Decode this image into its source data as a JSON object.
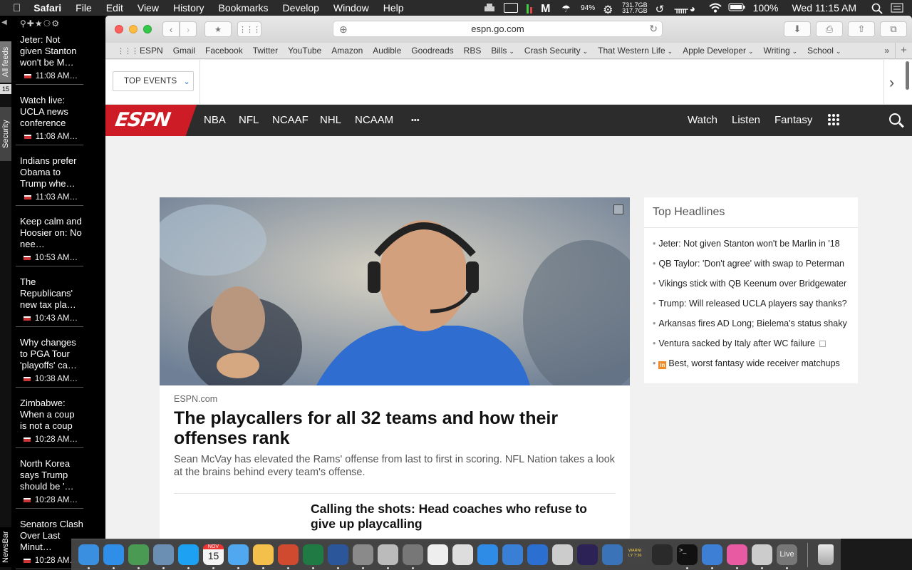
{
  "menubar": {
    "app": "Safari",
    "items": [
      "File",
      "Edit",
      "View",
      "History",
      "Bookmarks",
      "Develop",
      "Window",
      "Help"
    ],
    "battery_icon_pct": "94%",
    "disk_top": "731.7GB",
    "disk_bottom": "317.7GB",
    "battery_pct": "100%",
    "clock": "Wed 11:15 AM"
  },
  "newsbar": {
    "tab_all_feeds": "All feeds",
    "tab_count": "15",
    "tab_security": "Security",
    "tab_newsbar": "NewsBar",
    "items": [
      {
        "title": "Jeter: Not given Stanton won't be M…",
        "time": "11:08 AM…"
      },
      {
        "title": "Watch live: UCLA news conference",
        "time": "11:08 AM…"
      },
      {
        "title": "Indians prefer Obama to Trump whe…",
        "time": "11:03 AM…"
      },
      {
        "title": "Keep calm and Hoosier on: No nee…",
        "time": "10:53 AM…"
      },
      {
        "title": "The Republicans' new tax pla…",
        "time": "10:43 AM…"
      },
      {
        "title": "Why changes to PGA Tour 'playoffs' ca…",
        "time": "10:38 AM…"
      },
      {
        "title": "Zimbabwe: When a coup is not a coup",
        "time": "10:28 AM…"
      },
      {
        "title": "North Korea says Trump should be '…",
        "time": "10:28 AM…"
      },
      {
        "title": "Senators Clash Over Last Minut…",
        "time": "10:28 AM…"
      }
    ]
  },
  "browser": {
    "url": "espn.go.com",
    "favorites": [
      {
        "label": "ESPN",
        "menu": false
      },
      {
        "label": "Gmail",
        "menu": false
      },
      {
        "label": "Facebook",
        "menu": false
      },
      {
        "label": "Twitter",
        "menu": false
      },
      {
        "label": "YouTube",
        "menu": false
      },
      {
        "label": "Amazon",
        "menu": false
      },
      {
        "label": "Audible",
        "menu": false
      },
      {
        "label": "Goodreads",
        "menu": false
      },
      {
        "label": "RBS",
        "menu": false
      },
      {
        "label": "Bills",
        "menu": true
      },
      {
        "label": "Crash Security",
        "menu": true
      },
      {
        "label": "That Western Life",
        "menu": true
      },
      {
        "label": "Apple Developer",
        "menu": true
      },
      {
        "label": "Writing",
        "menu": true
      },
      {
        "label": "School",
        "menu": true
      }
    ],
    "favorites_more": "»"
  },
  "page": {
    "top_events": "TOP EVENTS",
    "logo": "ESPN",
    "nav_left": [
      "NBA",
      "NFL",
      "NCAAF",
      "NHL",
      "NCAAM"
    ],
    "nav_more": "•••",
    "nav_right": [
      "Watch",
      "Listen",
      "Fantasy"
    ],
    "hero": {
      "source": "ESPN.com",
      "title": "The playcallers for all 32 teams and how their offenses rank",
      "description": "Sean McVay has elevated the Rams' offense from last to first in scoring. NFL Nation takes a look at the brains behind every team's offense."
    },
    "sub_story": {
      "title": "Calling the shots: Head coaches who refuse to give up playcalling"
    },
    "headlines": {
      "title": "Top Headlines",
      "items": [
        {
          "text": "Jeter: Not given Stanton won't be Marlin in '18",
          "external": false,
          "insider": false
        },
        {
          "text": "QB Taylor: 'Don't agree' with swap to Peterman",
          "external": false,
          "insider": false
        },
        {
          "text": "Vikings stick with QB Keenum over Bridgewater",
          "external": false,
          "insider": false
        },
        {
          "text": "Trump: Will released UCLA players say thanks?",
          "external": false,
          "insider": false
        },
        {
          "text": "Arkansas fires AD Long; Bielema's status shaky",
          "external": false,
          "insider": false
        },
        {
          "text": "Ventura sacked by Italy after WC failure",
          "external": true,
          "insider": false
        },
        {
          "text": "Best, worst fantasy wide receiver matchups",
          "external": false,
          "insider": true
        }
      ]
    }
  },
  "dock": {
    "apps": [
      {
        "name": "finder",
        "color": "#3b8fe0"
      },
      {
        "name": "safari",
        "color": "#2f8ee8"
      },
      {
        "name": "chrome-like",
        "color": "#4a9a54"
      },
      {
        "name": "preview",
        "color": "#6a8fb3"
      },
      {
        "name": "twitter",
        "color": "#1da1f2"
      },
      {
        "name": "calendar",
        "color": "#f4f4f4"
      },
      {
        "name": "messages",
        "color": "#4fa8f0"
      },
      {
        "name": "photos",
        "color": "#f2c04b"
      },
      {
        "name": "powerpoint",
        "color": "#d04a2f"
      },
      {
        "name": "excel",
        "color": "#1f7a43"
      },
      {
        "name": "word",
        "color": "#2b579a"
      },
      {
        "name": "system-preferences",
        "color": "#8a8a8a"
      },
      {
        "name": "app-13",
        "color": "#bbb"
      },
      {
        "name": "automator",
        "color": "#777"
      },
      {
        "name": "notes",
        "color": "#eee"
      },
      {
        "name": "script-editor",
        "color": "#ddd"
      },
      {
        "name": "app-store",
        "color": "#2e8be6"
      },
      {
        "name": "sharkfin",
        "color": "#3a7fd6"
      },
      {
        "name": "xcode",
        "color": "#2b6fd0"
      },
      {
        "name": "penguin",
        "color": "#ccc"
      },
      {
        "name": "eclipse",
        "color": "#2c2255"
      },
      {
        "name": "vmware",
        "color": "#3b73b9"
      },
      {
        "name": "console",
        "color": "#444"
      },
      {
        "name": "activity-monitor",
        "color": "#2a2a2a"
      },
      {
        "name": "terminal",
        "color": "#111"
      },
      {
        "name": "nordvpn",
        "color": "#3e7fd6"
      },
      {
        "name": "itunes",
        "color": "#e85aa1"
      },
      {
        "name": "scrivener",
        "color": "#ccc"
      },
      {
        "name": "live",
        "color": "#777"
      }
    ],
    "calendar_month": "NOV",
    "calendar_day": "15",
    "console_text": "WARNI\nLY 7:36",
    "live_label": "Live"
  }
}
